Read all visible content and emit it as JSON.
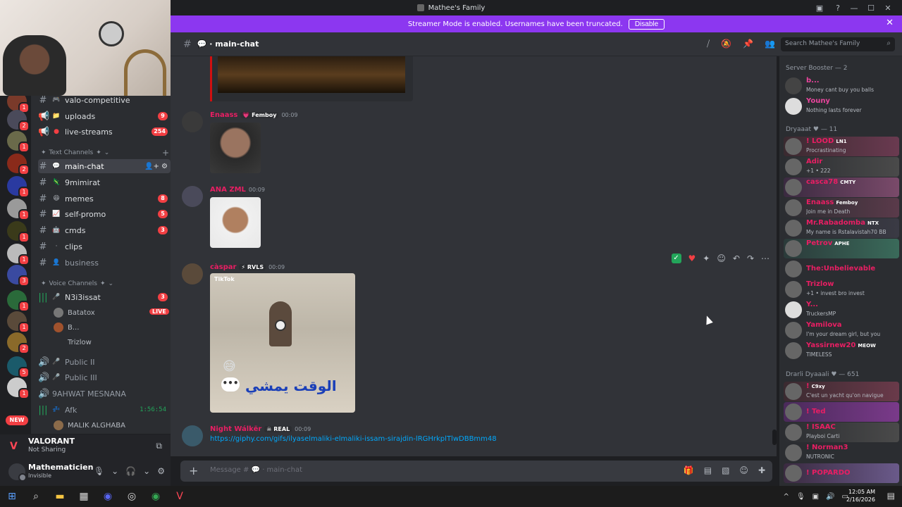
{
  "window": {
    "title": "Mathee's Family"
  },
  "banner": {
    "text": "Streamer Mode is enabled. Usernames have been truncated.",
    "button": "Disable"
  },
  "servers": [
    {
      "badge": "1"
    },
    {
      "badge": "2"
    },
    {
      "badge": "1"
    },
    {
      "badge": "2"
    },
    {
      "badge": "1"
    },
    {
      "badge": "1"
    },
    {
      "badge": "1"
    },
    {
      "badge": "1"
    },
    {
      "badge": "3"
    },
    {
      "badge": "1"
    },
    {
      "badge": "1"
    },
    {
      "badge": "2"
    },
    {
      "badge": "5"
    },
    {
      "badge": "1"
    }
  ],
  "new_label": "NEW",
  "channels": {
    "top": [
      {
        "name": "valo-competitive",
        "count": ""
      },
      {
        "name": "uploads",
        "count": "9"
      },
      {
        "name": "live-streams",
        "count": "254"
      }
    ],
    "text_category": "Text Channels",
    "text": [
      {
        "name": "main-chat",
        "count": "",
        "active": true
      },
      {
        "name": "9mimirat",
        "count": ""
      },
      {
        "name": "memes",
        "count": "8"
      },
      {
        "name": "self-promo",
        "count": "5"
      },
      {
        "name": "cmds",
        "count": "3"
      },
      {
        "name": "clips",
        "count": ""
      },
      {
        "name": "business",
        "count": ""
      }
    ],
    "voice_category": "Voice Channels",
    "voice": [
      {
        "name": "N3i3issat",
        "count": "3"
      },
      {
        "name": "Public II"
      },
      {
        "name": "Public III"
      },
      {
        "name": "9AHWAT MESNANA"
      },
      {
        "name": "Afk",
        "timer": "1:56:54"
      }
    ],
    "voice_users": [
      "Batatox",
      "B...",
      "Trizlow",
      "MALIK ALGHABA"
    ],
    "live_label": "LIVE"
  },
  "activity": {
    "game": "VALORANT",
    "status": "Not Sharing"
  },
  "user": {
    "name": "Mathematicien",
    "status": "Invisible"
  },
  "chat": {
    "channel": "main-chat",
    "search_placeholder": "Search Mathee's Family",
    "composer_placeholder": "Message # 💬 · main-chat"
  },
  "messages": [
    {
      "user": "Enaass",
      "tag": "Femboy",
      "time": "00:09"
    },
    {
      "user": "ANA ZML",
      "tag": "",
      "time": "00:09"
    },
    {
      "user": "càspar",
      "tag": "RVLS",
      "time": "00:09",
      "overlay_text": "الوقت يمشي",
      "tiktok": "TikTok"
    },
    {
      "user": "Night Wálkër",
      "tag": "REAL",
      "time": "00:09",
      "link": "https://giphy.com/gifs/ilyaselmaliki-elmaliki-issam-sirajdin-lRGHrkplTlwDBBmm48"
    }
  ],
  "members": {
    "cat1": "Server Booster — 2",
    "booster": [
      {
        "name": "b...",
        "status": "Money cant buy you balls",
        "color": "#eb459e"
      },
      {
        "name": "Youny",
        "status": "Nothing lasts forever",
        "color": "#eb459e"
      }
    ],
    "cat2": "Dryaaat ♥ — 11",
    "dryaaat": [
      {
        "name": "! LOOD",
        "tag": "LN1",
        "status": "Procrastinating",
        "color": "#e91e63"
      },
      {
        "name": "Adir",
        "tag": "",
        "status": "+1 • 222",
        "color": "#e91e63"
      },
      {
        "name": "casca78",
        "tag": "CMTY",
        "status": "",
        "color": "#e91e63"
      },
      {
        "name": "Enaass",
        "tag": "Femboy",
        "status": "Join me in Death",
        "color": "#e91e63"
      },
      {
        "name": "Mr.Rabadomba",
        "tag": "NTX",
        "status": "My name is Rstalavistah70 BB",
        "color": "#e91e63"
      },
      {
        "name": "Petrov",
        "tag": "APHE",
        "status": "",
        "color": "#e91e63"
      },
      {
        "name": "The:Unbelievable",
        "tag": "",
        "status": "",
        "color": "#e91e63"
      },
      {
        "name": "Trizlow",
        "tag": "",
        "status": "+1 • invest bro invest",
        "color": "#e91e63"
      },
      {
        "name": "Y...",
        "tag": "",
        "status": "TruckersMP",
        "color": "#e91e63"
      },
      {
        "name": "Yamilova",
        "tag": "",
        "status": "I'm your dream girl, but you",
        "color": "#e91e63"
      },
      {
        "name": "Yassirnew20",
        "tag": "MEOW",
        "status": "TIMELESS",
        "color": "#e91e63"
      }
    ],
    "cat3": "Drarli Dyaaali ♥ — 651",
    "drarli": [
      {
        "name": "!",
        "tag": "C9xy",
        "status": "C'est un yacht qu'on navigue",
        "color": "#e91e63"
      },
      {
        "name": "! Ted",
        "tag": "",
        "status": "",
        "color": "#e91e63"
      },
      {
        "name": "! ISAAC",
        "tag": "",
        "status": "Playboi Carti",
        "color": "#e91e63"
      },
      {
        "name": "! Norman3",
        "tag": "",
        "status": "NUTRONIC",
        "color": "#e91e63"
      },
      {
        "name": "! POPARDO",
        "tag": "",
        "status": "",
        "color": "#e91e63"
      }
    ]
  },
  "taskbar": {
    "time": "12:05 AM",
    "date": "2/16/2026"
  }
}
